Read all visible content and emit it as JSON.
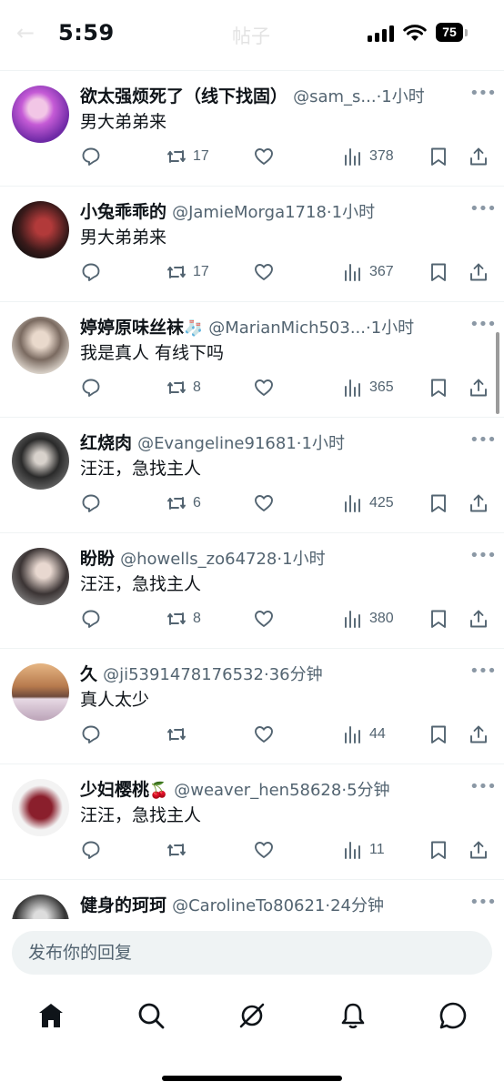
{
  "status_bar": {
    "time": "5:59",
    "battery": "75",
    "faint_back": "←",
    "faint_title": "帖子"
  },
  "tweets": [
    {
      "name": "欲太强烦死了（线下找固）",
      "emoji": "",
      "handle": "@sam_s...",
      "time": "1小时",
      "text": "男大弟弟来",
      "retweets": "17",
      "views": "378"
    },
    {
      "name": "小兔乖乖的",
      "emoji": "",
      "handle": "@JamieMorga1718",
      "time": "1小时",
      "text": "男大弟弟来",
      "retweets": "17",
      "views": "367"
    },
    {
      "name": "婷婷原味丝袜",
      "emoji": "🧦",
      "handle": "@MarianMich503...",
      "time": "1小时",
      "text": "我是真人 有线下吗",
      "retweets": "8",
      "views": "365"
    },
    {
      "name": "红烧肉",
      "emoji": "",
      "handle": "@Evangeline91681",
      "time": "1小时",
      "text": "汪汪，急找主人",
      "retweets": "6",
      "views": "425"
    },
    {
      "name": "盼盼",
      "emoji": "",
      "handle": "@howells_zo64728",
      "time": "1小时",
      "text": "汪汪，急找主人",
      "retweets": "8",
      "views": "380"
    },
    {
      "name": "久",
      "emoji": "",
      "handle": "@ji5391478176532",
      "time": "36分钟",
      "text": "真人太少",
      "retweets": "",
      "views": "44"
    },
    {
      "name": "少妇樱桃",
      "emoji": "🍒",
      "handle": "@weaver_hen58628",
      "time": "5分钟",
      "text": "汪汪，急找主人",
      "retweets": "",
      "views": "11"
    },
    {
      "name": "健身的珂珂",
      "emoji": "",
      "handle": "@CarolineTo80621",
      "time": "24分钟",
      "text": "",
      "retweets": "",
      "views": ""
    }
  ],
  "reply": {
    "placeholder": "发布你的回复"
  },
  "nav": {
    "items": [
      "home-icon",
      "search-icon",
      "grok-icon",
      "notifications-icon",
      "messages-icon"
    ]
  },
  "colors": {
    "text": "#0f1419",
    "secondary": "#536471",
    "divider": "#eff3f4",
    "input_bg": "#eff3f4"
  }
}
